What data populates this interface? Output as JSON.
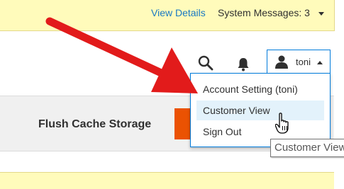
{
  "header": {
    "view_details_label": "View Details",
    "system_messages_label": "System Messages: 3"
  },
  "toolbar": {
    "search_icon": "search-icon",
    "notifications_icon": "bell-icon",
    "user_name": "toni"
  },
  "account_menu": {
    "items": [
      {
        "label": "Account Setting (toni)"
      },
      {
        "label": "Customer View"
      },
      {
        "label": "Sign Out"
      }
    ],
    "hovered_item": "Customer View"
  },
  "tooltip": {
    "text": "Customer View"
  },
  "page_actions": {
    "flush_cache_label": "Flush Cache Storage"
  },
  "colors": {
    "message_bar": "#fffbbb",
    "link": "#1979c3",
    "focus_border": "#007bdb",
    "primary_button": "#eb5202",
    "annotation_arrow": "#e21b1b"
  }
}
